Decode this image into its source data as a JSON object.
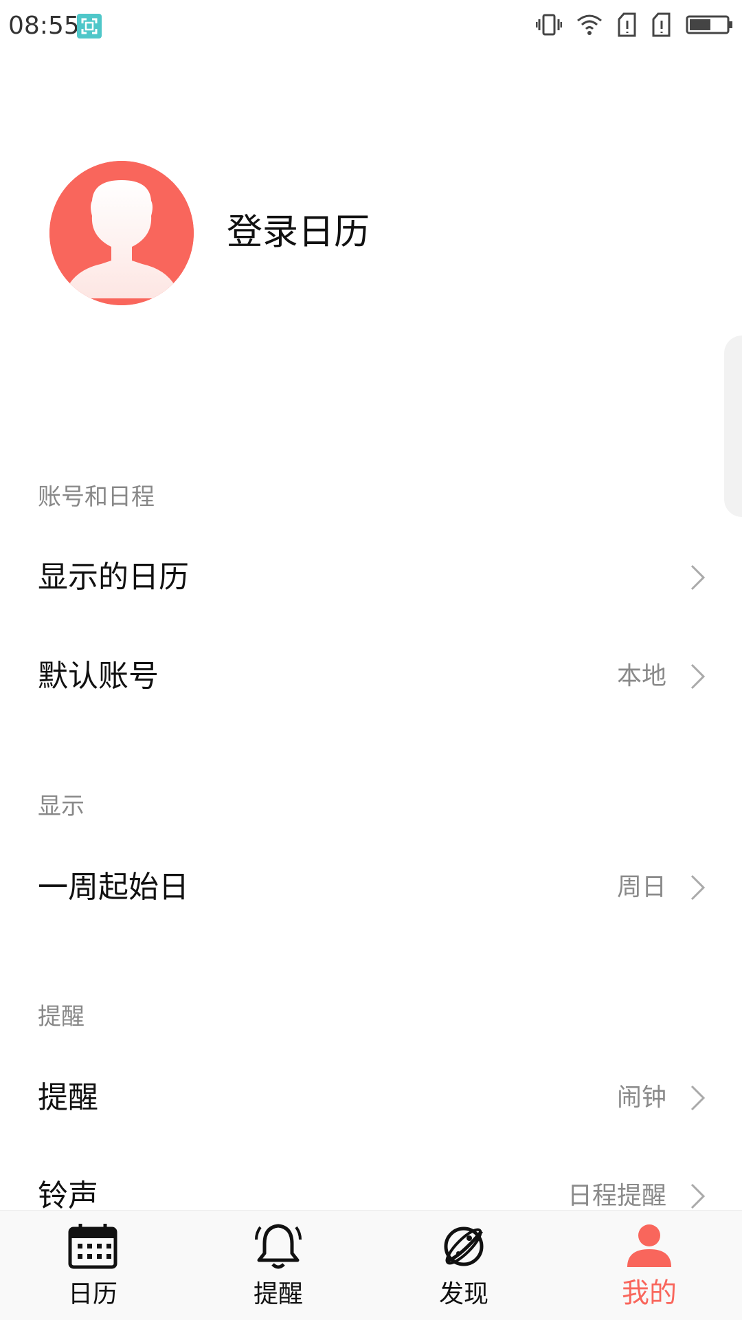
{
  "status_bar": {
    "time": "08:55",
    "icons": [
      "screenshot-icon",
      "vibrate-icon",
      "wifi-icon",
      "sim1-icon",
      "sim2-icon",
      "battery-icon"
    ]
  },
  "profile": {
    "login_label": "登录日历",
    "avatar_color": "#f9665c"
  },
  "sections": {
    "account": {
      "header": "账号和日程",
      "display_calendars": {
        "label": "显示的日历"
      },
      "default_account": {
        "label": "默认账号",
        "value": "本地"
      }
    },
    "display": {
      "header": "显示",
      "week_start": {
        "label": "一周起始日",
        "value": "周日"
      }
    },
    "reminder": {
      "header": "提醒",
      "reminder": {
        "label": "提醒",
        "value": "闹钟"
      },
      "ringtone": {
        "label": "铃声",
        "value": "日程提醒"
      }
    }
  },
  "bottom_nav": {
    "calendar": "日历",
    "reminder": "提醒",
    "discover": "发现",
    "mine": "我的",
    "active": "mine",
    "active_color": "#f9665c"
  }
}
